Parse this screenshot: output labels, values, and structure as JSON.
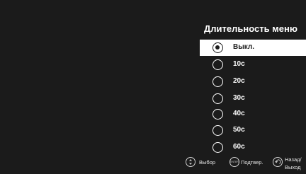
{
  "menu": {
    "title": "Длительность меню",
    "options": [
      {
        "label": "Выкл.",
        "selected": true
      },
      {
        "label": "10с",
        "selected": false
      },
      {
        "label": "20с",
        "selected": false
      },
      {
        "label": "30с",
        "selected": false
      },
      {
        "label": "40с",
        "selected": false
      },
      {
        "label": "50с",
        "selected": false
      },
      {
        "label": "60с",
        "selected": false
      }
    ]
  },
  "hints": {
    "select_label": "Выбор",
    "select_icon": "up-down-arrows-icon",
    "confirm_label": "Подтвер.",
    "confirm_icon": "enter-icon",
    "confirm_icon_text": "ENTER",
    "back_label_line1": "Назад/",
    "back_label_line2": "Выход",
    "back_icon": "return-arrow-icon"
  },
  "colors": {
    "background": "#1b1b1b",
    "highlight": "#ffffff",
    "text": "#ffffff"
  }
}
